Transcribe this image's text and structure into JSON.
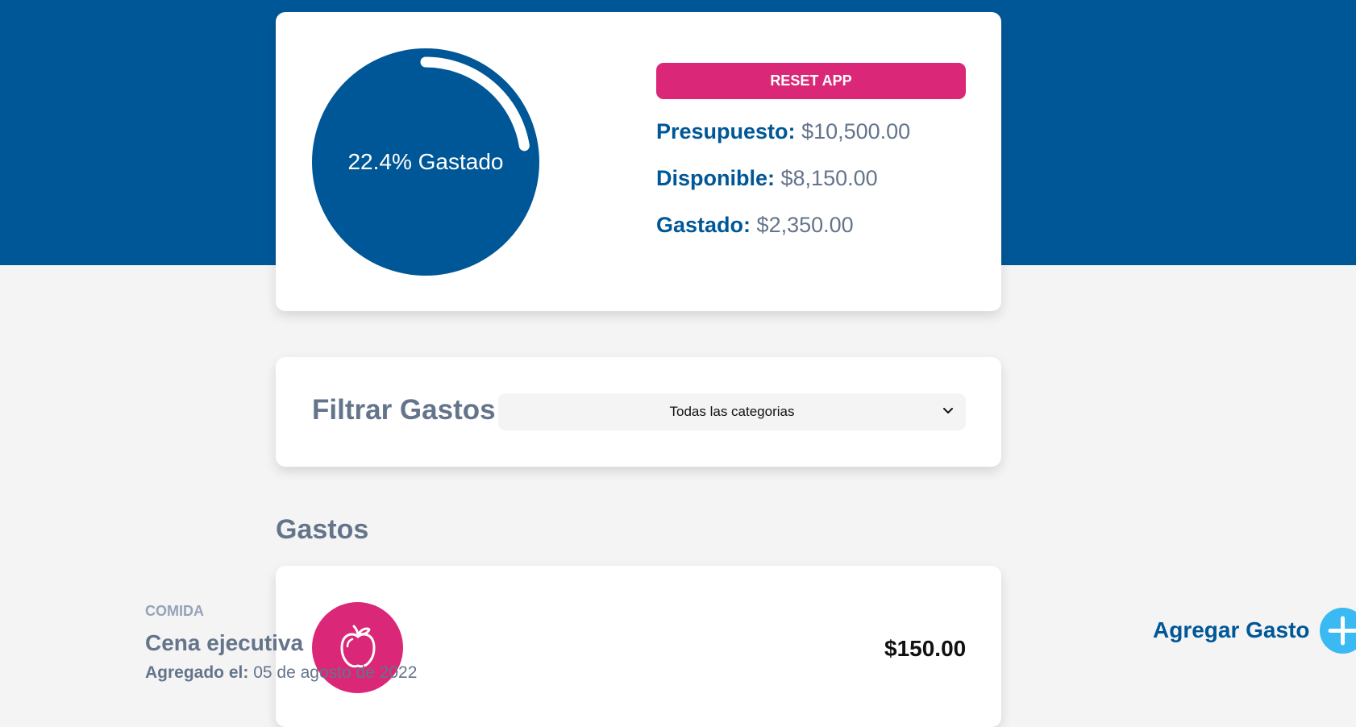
{
  "colors": {
    "brand_blue": "#005797",
    "accent_pink": "#db2777",
    "plus_button": "#3bb9f2",
    "background": "#f4f4f4"
  },
  "budget": {
    "progress_percent": 22.4,
    "progress_label": "22.4% Gastado",
    "reset_label": "RESET APP",
    "presupuesto_label": "Presupuesto:",
    "presupuesto_value": "$10,500.00",
    "disponible_label": "Disponible:",
    "disponible_value": "$8,150.00",
    "gastado_label": "Gastado:",
    "gastado_value": "$2,350.00"
  },
  "filter": {
    "title": "Filtrar Gastos",
    "selected_option": "Todas las categorias",
    "icon": "chevron-down-icon"
  },
  "expenses": {
    "title": "Gastos",
    "items": [
      {
        "category": "COMIDA",
        "name": "Cena ejecutiva",
        "date_label": "Agregado el:",
        "date": "05 de agosto de 2022",
        "amount": "$150.00",
        "icon": "apple-icon"
      }
    ]
  },
  "add_expense": {
    "label": "Agregar Gasto",
    "icon": "plus-icon"
  }
}
